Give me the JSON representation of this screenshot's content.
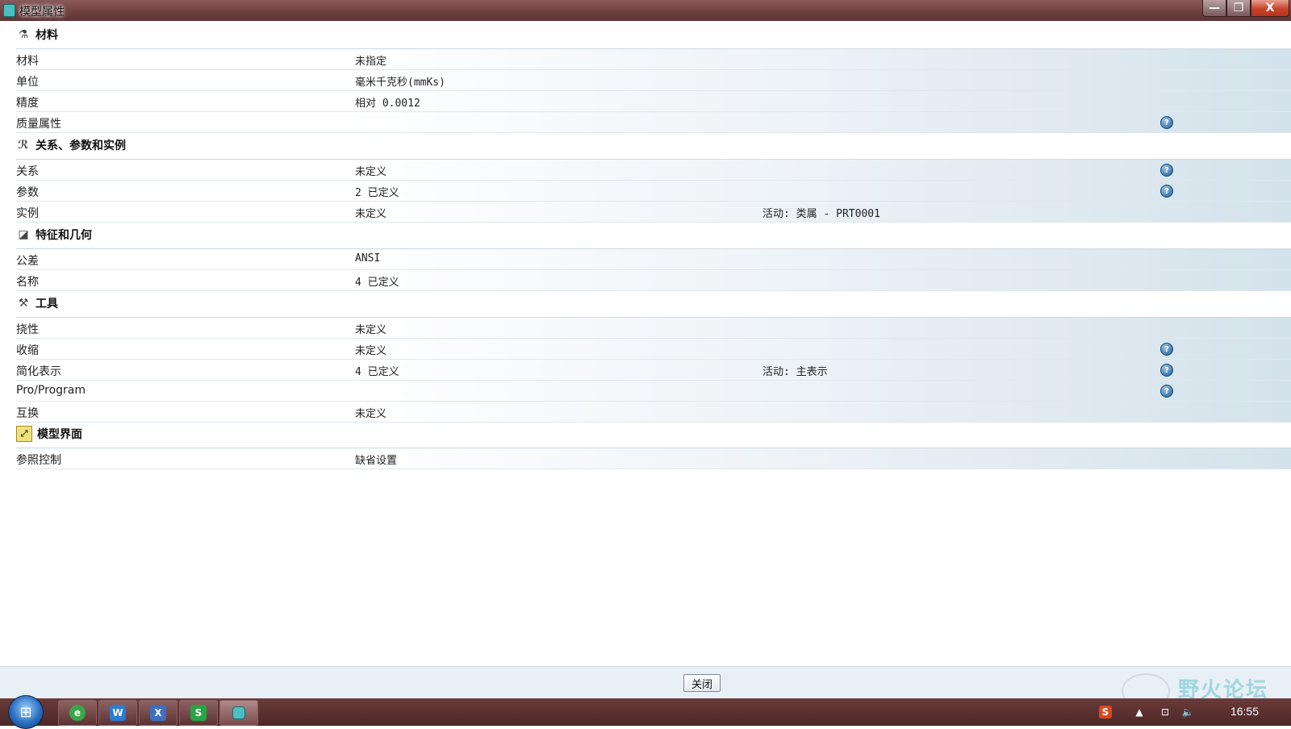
{
  "window": {
    "title": "模型属性",
    "close_icon_text": "X",
    "max_icon_text": "❐",
    "min_icon_text": "—"
  },
  "sections": {
    "material": {
      "title": "材料",
      "rows": [
        {
          "label": "材料",
          "value": "未指定"
        },
        {
          "label": "单位",
          "value": "毫米千克秒(mmKs)"
        },
        {
          "label": "精度",
          "value": "相对 0.0012"
        },
        {
          "label": "质量属性",
          "value": ""
        }
      ]
    },
    "relations": {
      "title": "关系、参数和实例",
      "rows": [
        {
          "label": "关系",
          "value": "未定义"
        },
        {
          "label": "参数",
          "value": "2 已定义"
        },
        {
          "label": "实例",
          "value": "未定义",
          "extra": "活动: 类属 - PRT0001"
        }
      ]
    },
    "features": {
      "title": "特征和几何",
      "rows": [
        {
          "label": "公差",
          "value": "ANSI"
        },
        {
          "label": "名称",
          "value": "4 已定义"
        }
      ]
    },
    "tools": {
      "title": "工具",
      "rows": [
        {
          "label": "挠性",
          "value": "未定义"
        },
        {
          "label": "收缩",
          "value": "未定义"
        },
        {
          "label": "简化表示",
          "value": "4 已定义",
          "extra": "活动: 主表示"
        },
        {
          "label": "Pro/Program",
          "value": ""
        },
        {
          "label": "互换",
          "value": "未定义"
        }
      ]
    },
    "interface": {
      "title": "模型界面",
      "rows": [
        {
          "label": "参照控制",
          "value": "缺省设置"
        }
      ]
    }
  },
  "help_icon_text": "?",
  "bottom": {
    "close_label": "关闭",
    "watermark_text": "野火论坛"
  },
  "taskbar": {
    "start_glyph": "⊞",
    "items": [
      {
        "name": "browser-icon",
        "glyph": "e",
        "color": "#3aa64a"
      },
      {
        "name": "word-icon",
        "glyph": "W",
        "color": "#2b7cd3"
      },
      {
        "name": "app-x-icon",
        "glyph": "X",
        "color": "#3f6fbf"
      },
      {
        "name": "spreadsheet-icon",
        "glyph": "S",
        "color": "#27a544"
      },
      {
        "name": "model-window-icon",
        "glyph": "",
        "color": "#4bbfc2"
      }
    ],
    "tray_s_glyph": "S",
    "clock": "16:55"
  }
}
